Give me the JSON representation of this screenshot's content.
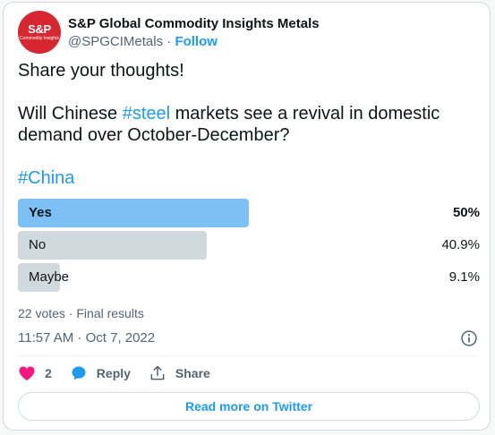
{
  "account": {
    "display_name": "S&P Global Commodity Insights Metals",
    "handle": "@SPGCIMetals",
    "separator": " · ",
    "follow_label": "Follow",
    "avatar_main": "S&P",
    "avatar_sub": "Commodity Insights",
    "avatar_color": "#d6262f"
  },
  "tweet": {
    "line1": "Share your thoughts!",
    "line2_before": "Will Chinese ",
    "line2_hashtag": "#steel",
    "line2_after": " markets see a revival in domestic demand over October-December?",
    "hashtag_china": "#China"
  },
  "poll": {
    "options": [
      {
        "label": "Yes",
        "percent_text": "50%",
        "percent": 50,
        "winner": true
      },
      {
        "label": "No",
        "percent_text": "40.9%",
        "percent": 40.9,
        "winner": false
      },
      {
        "label": "Maybe",
        "percent_text": "9.1%",
        "percent": 9.1,
        "winner": false
      }
    ],
    "summary": "22 votes · Final results"
  },
  "timestamp": "11:57 AM · Oct 7, 2022",
  "actions": {
    "like_count": "2",
    "reply_label": "Reply",
    "share_label": "Share"
  },
  "read_more_label": "Read more on Twitter",
  "colors": {
    "accent": "#1d9bf0",
    "like": "#f91880",
    "winner_bar": "#7cc0f4",
    "other_bar": "#cfd9de"
  }
}
